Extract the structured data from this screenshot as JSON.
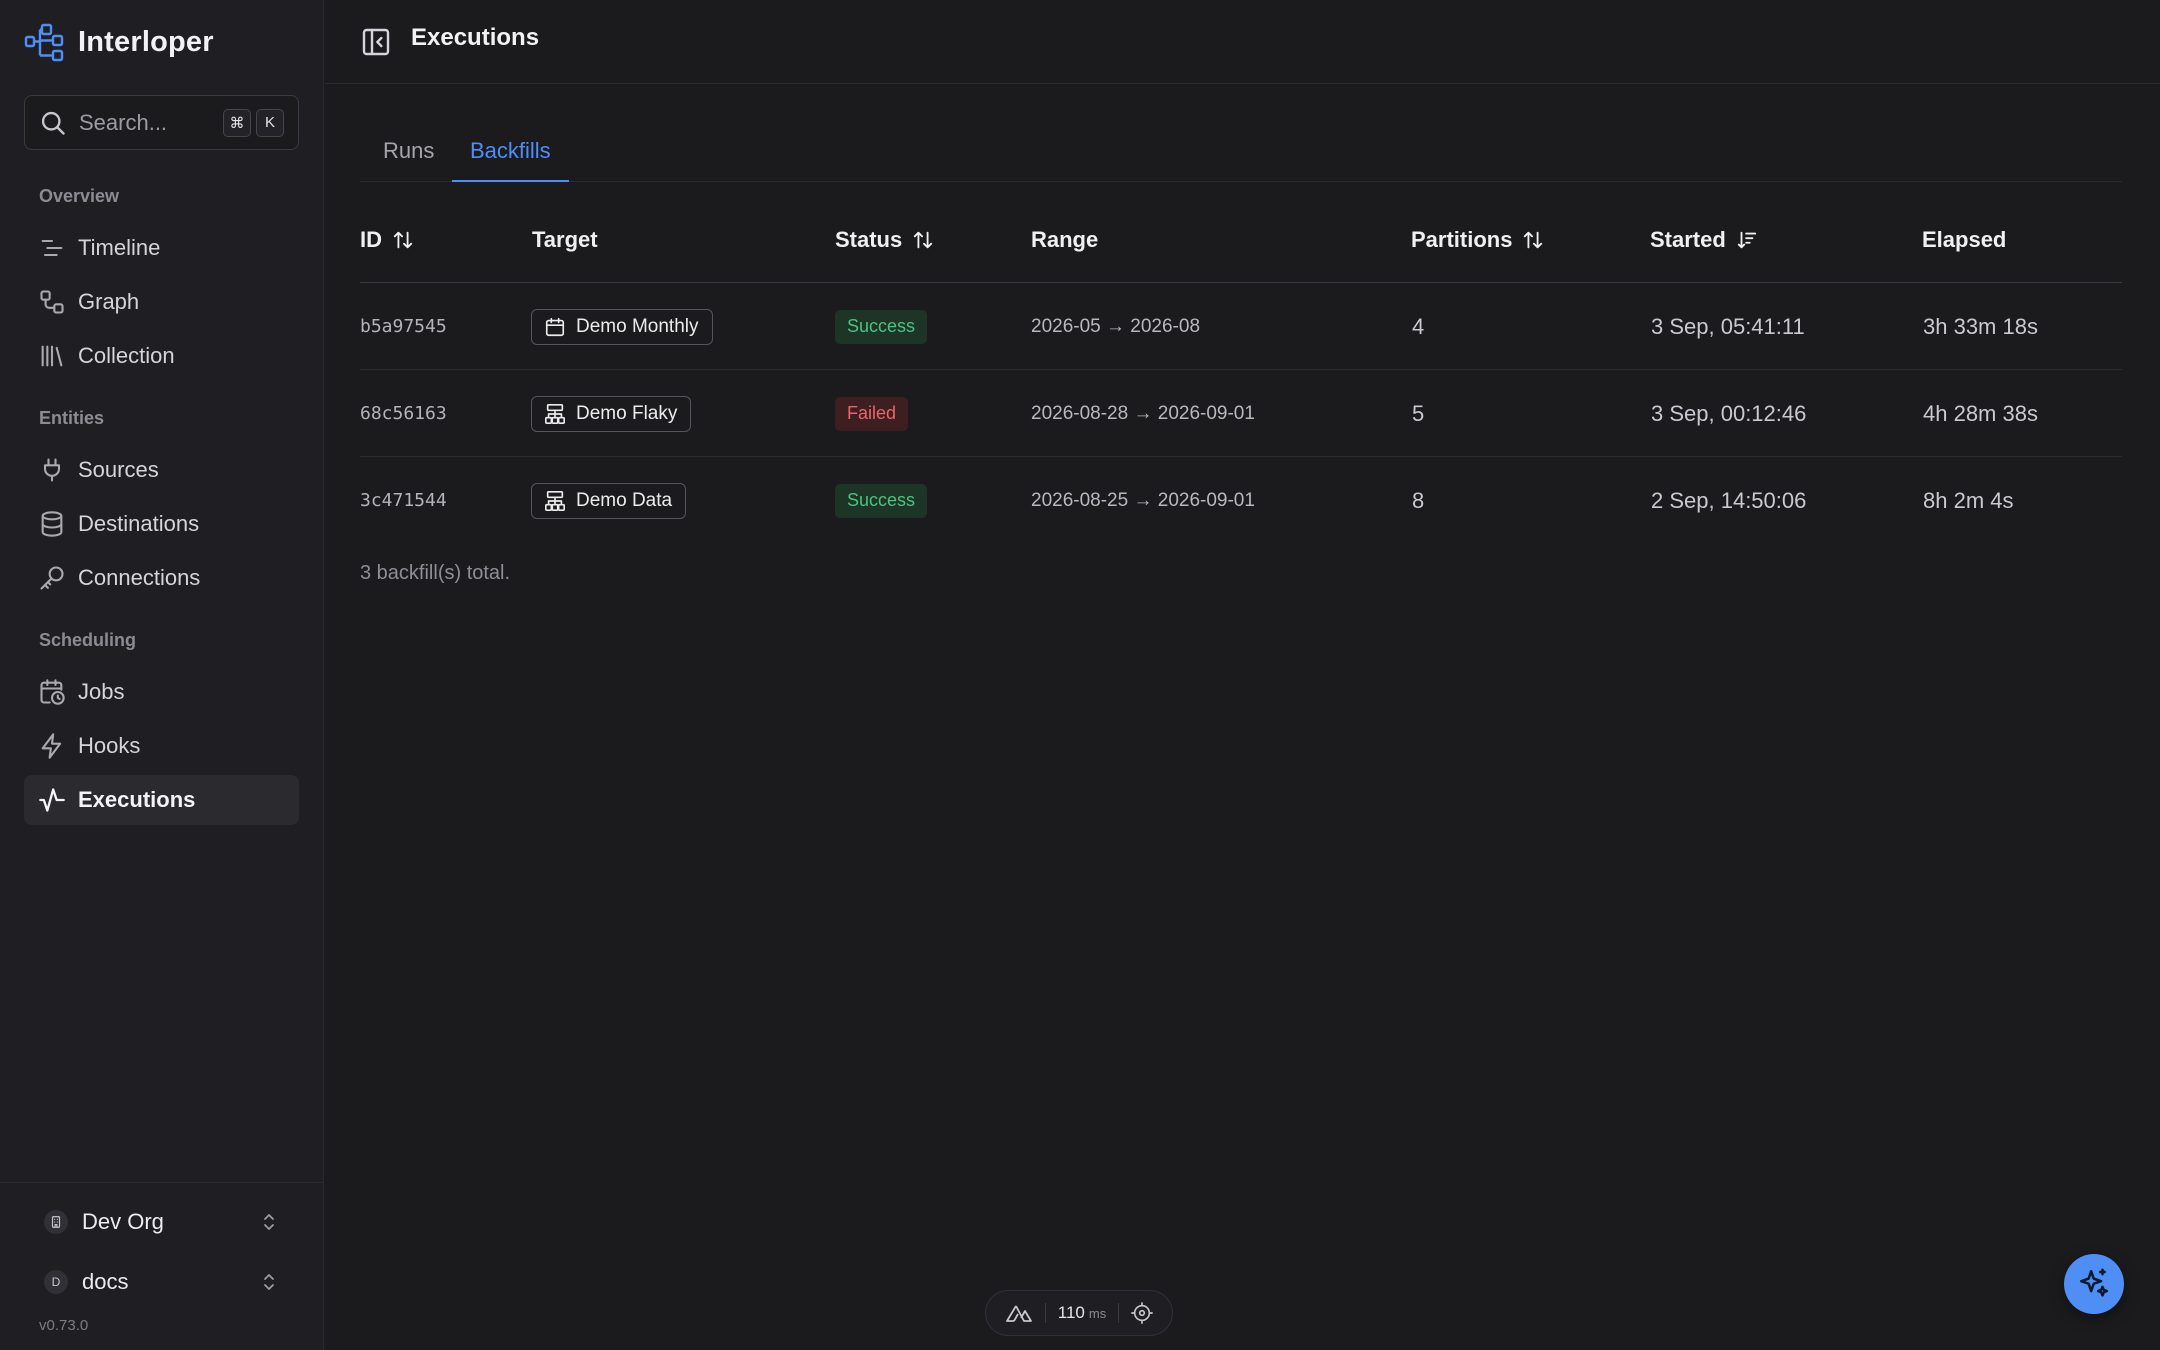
{
  "app": {
    "name": "Interloper",
    "version": "v0.73.0"
  },
  "search": {
    "placeholder": "Search...",
    "shortcut_mod": "⌘",
    "shortcut_key": "K"
  },
  "sidebar": {
    "sections": [
      {
        "label": "Overview"
      },
      {
        "label": "Entities"
      },
      {
        "label": "Scheduling"
      }
    ],
    "items": [
      {
        "label": "Timeline",
        "icon": "timeline-icon"
      },
      {
        "label": "Graph",
        "icon": "graph-icon"
      },
      {
        "label": "Collection",
        "icon": "library-icon"
      },
      {
        "label": "Sources",
        "icon": "plug-icon"
      },
      {
        "label": "Destinations",
        "icon": "database-icon"
      },
      {
        "label": "Connections",
        "icon": "key-icon"
      },
      {
        "label": "Jobs",
        "icon": "calendar-clock-icon"
      },
      {
        "label": "Hooks",
        "icon": "zap-icon"
      },
      {
        "label": "Executions",
        "icon": "activity-icon",
        "active": true
      }
    ],
    "org": {
      "label": "Dev Org",
      "icon": "building-icon"
    },
    "workspace": {
      "label": "docs",
      "avatar": "D"
    }
  },
  "header": {
    "title": "Executions"
  },
  "tabs": [
    {
      "label": "Runs",
      "active": false
    },
    {
      "label": "Backfills",
      "active": true
    }
  ],
  "table": {
    "columns": [
      "ID",
      "Target",
      "Status",
      "Range",
      "Partitions",
      "Started",
      "Elapsed"
    ],
    "rows": [
      {
        "id": "b5a97545",
        "target": "Demo Monthly",
        "target_icon": "calendar-icon",
        "status": "Success",
        "range": "2026-05 → 2026-08",
        "partitions": "4",
        "started": "3 Sep, 05:41:11",
        "elapsed": "3h 33m 18s"
      },
      {
        "id": "68c56163",
        "target": "Demo Flaky",
        "target_icon": "network-icon",
        "status": "Failed",
        "range": "2026-08-28 → 2026-09-01",
        "partitions": "5",
        "started": "3 Sep, 00:12:46",
        "elapsed": "4h 28m 38s"
      },
      {
        "id": "3c471544",
        "target": "Demo Data",
        "target_icon": "network-icon",
        "status": "Success",
        "range": "2026-08-25 → 2026-09-01",
        "partitions": "8",
        "started": "2 Sep, 14:50:06",
        "elapsed": "8h 2m 4s"
      }
    ],
    "total_text": "3 backfill(s) total."
  },
  "devtools": {
    "render_ms": "110",
    "unit": "ms"
  },
  "colors": {
    "accent": "#4e8ef5",
    "success": "#4cc280",
    "failed": "#e8656b",
    "background": "#1b1b1e"
  }
}
